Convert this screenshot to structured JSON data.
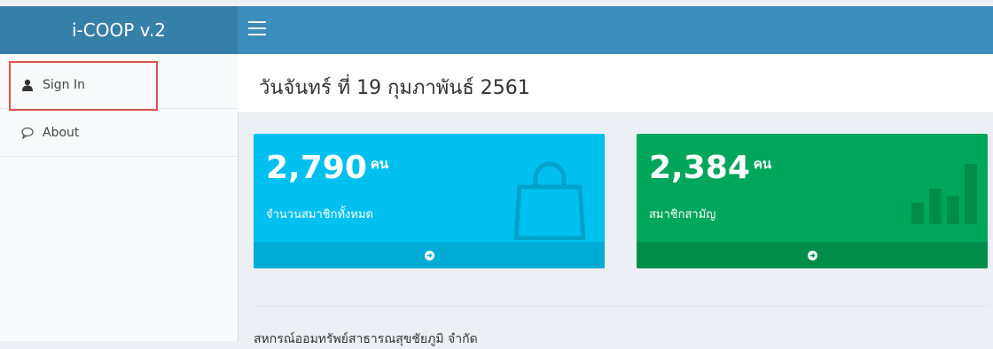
{
  "app": {
    "title": "i-COOP v.2"
  },
  "sidebar": {
    "items": [
      {
        "label": "Sign In",
        "icon": "user-icon"
      },
      {
        "label": "About",
        "icon": "chat-bubble-icon"
      }
    ]
  },
  "header": {
    "date_title": "วันจันทร์ ที่ 19 กุมภาพันธ์ 2561"
  },
  "stats": [
    {
      "value": "2,790",
      "unit": "คน",
      "description": "จำนวนสมาชิกทั้งหมด",
      "color": "#00c0ef",
      "icon": "shopping-bag-icon"
    },
    {
      "value": "2,384",
      "unit": "คน",
      "description": "สมาชิกสามัญ",
      "color": "#00a65a",
      "icon": "bar-chart-icon"
    }
  ],
  "footer": {
    "org_name": "สหกรณ์ออมทรัพย์สาธารณสุขชัยภูมิ จำกัด"
  },
  "colors": {
    "topbar": "#3c8dbc",
    "brand": "#367fa9",
    "highlight": "#d9534f"
  }
}
